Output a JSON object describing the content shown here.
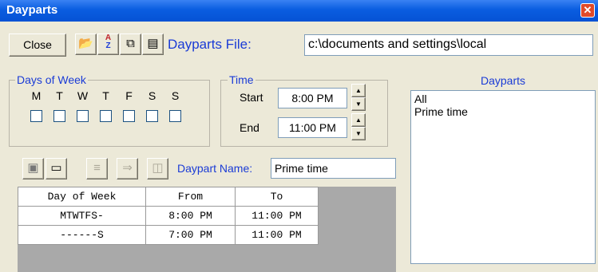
{
  "window": {
    "title": "Dayparts",
    "close_glyph": "✕"
  },
  "toolbar": {
    "close_label": "Close",
    "open_icon": "folder-open-icon",
    "sort_icon": "sort-az-icon",
    "copy_icon": "copy-icon",
    "note_icon": "note-icon",
    "file_label": "Dayparts File:",
    "file_value": "c:\\documents and settings\\local"
  },
  "days_of_week": {
    "legend": "Days of Week",
    "days": [
      "M",
      "T",
      "W",
      "T",
      "F",
      "S",
      "S"
    ]
  },
  "time": {
    "legend": "Time",
    "start_label": "Start",
    "start_value": "8:00 PM",
    "end_label": "End",
    "end_value": "11:00 PM"
  },
  "daypart_editor": {
    "name_label": "Daypart Name:",
    "name_value": "Prime time"
  },
  "grid": {
    "columns": [
      "Day of Week",
      "From",
      "To"
    ],
    "rows": [
      [
        "MTWTFS-",
        "8:00 PM",
        "11:00 PM"
      ],
      [
        "------S",
        "7:00 PM",
        "11:00 PM"
      ]
    ]
  },
  "dayparts_list": {
    "header": "Dayparts",
    "items": [
      "All",
      "Prime time"
    ]
  },
  "colors": {
    "label_blue": "#1a3bd6",
    "title_blue": "#0a5de0",
    "window_bg": "#ece9d8"
  }
}
